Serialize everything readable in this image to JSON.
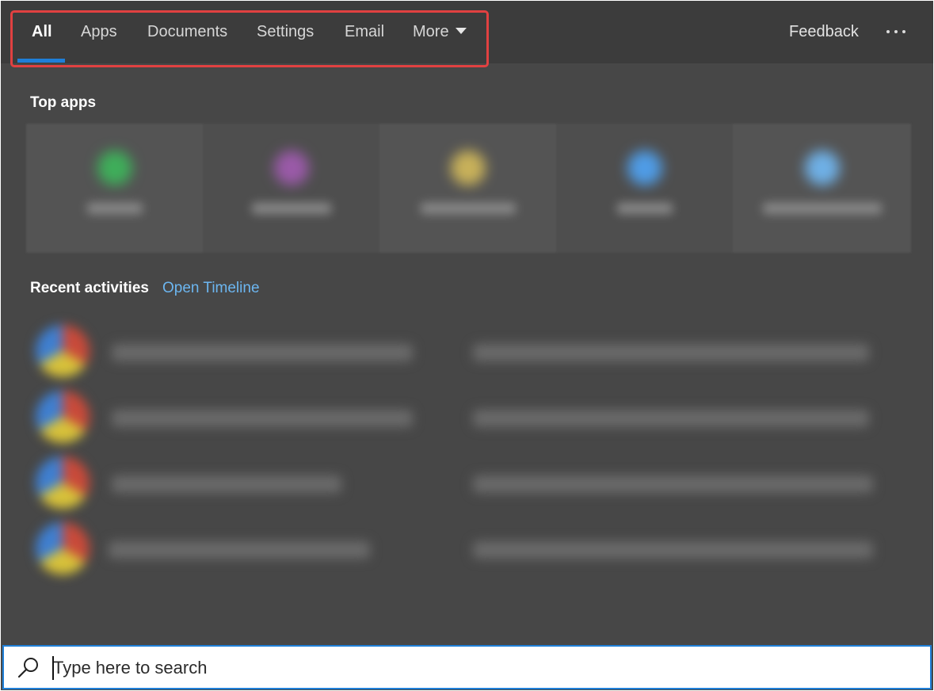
{
  "tabs": [
    {
      "label": "All",
      "active": true
    },
    {
      "label": "Apps",
      "active": false
    },
    {
      "label": "Documents",
      "active": false
    },
    {
      "label": "Settings",
      "active": false
    },
    {
      "label": "Email",
      "active": false
    },
    {
      "label": "More",
      "active": false
    }
  ],
  "header": {
    "feedback_label": "Feedback",
    "more_options_icon": "ellipsis-icon",
    "dropdown_icon": "caret-down-icon"
  },
  "top_apps": {
    "title": "Top apps",
    "items": [
      {
        "icon_color": "#3fae5a"
      },
      {
        "icon_color": "#9a5aa8"
      },
      {
        "icon_color": "#c8b15a"
      },
      {
        "icon_color": "#4f9ce6"
      },
      {
        "icon_color": "#6fb0e6"
      }
    ]
  },
  "recent": {
    "title": "Recent activities",
    "link_label": "Open Timeline",
    "items": [
      {},
      {},
      {},
      {}
    ]
  },
  "search": {
    "placeholder": "Type here to search",
    "value": ""
  },
  "colors": {
    "accent": "#1f7fd8",
    "highlight_box": "#e14141",
    "link": "#6cb6f0",
    "background": "#474747"
  }
}
